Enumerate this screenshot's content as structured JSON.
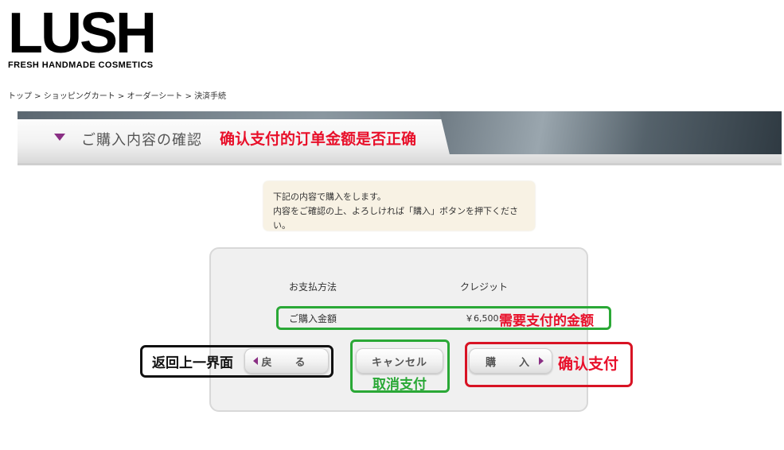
{
  "logo": {
    "main": "LUSH",
    "sub": "FRESH HANDMADE COSMETICS"
  },
  "breadcrumb": [
    "トップ",
    "ショッピングカート",
    "オーダーシート",
    "決済手続"
  ],
  "breadcrumb_separator": " > ",
  "banner": {
    "title": "ご購入内容の確認",
    "note": "确认支付的订单金额是否正确",
    "accent_color": "#8a2f84"
  },
  "info": {
    "line1": "下記の内容で購入をします。",
    "line2": "内容をご確認の上、よろしければ「購入」ボタンを押下ください。"
  },
  "order": {
    "payment_label": "お支払方法",
    "payment_value": "クレジット",
    "amount_label": "ご購入金額",
    "amount_value": "￥6,500"
  },
  "buttons": {
    "back": "戻　る",
    "cancel": "キャンセル",
    "buy": "購　入"
  },
  "annotations": {
    "amount": "需要支付的金额",
    "back": "返回上一界面",
    "cancel": "取消支付",
    "buy": "确认支付",
    "colors": {
      "red": "#e8102a",
      "green": "#2aa836",
      "black": "#111111"
    }
  },
  "icons": [
    "triangle-down-icon",
    "arrow-left-icon",
    "arrow-right-icon"
  ]
}
